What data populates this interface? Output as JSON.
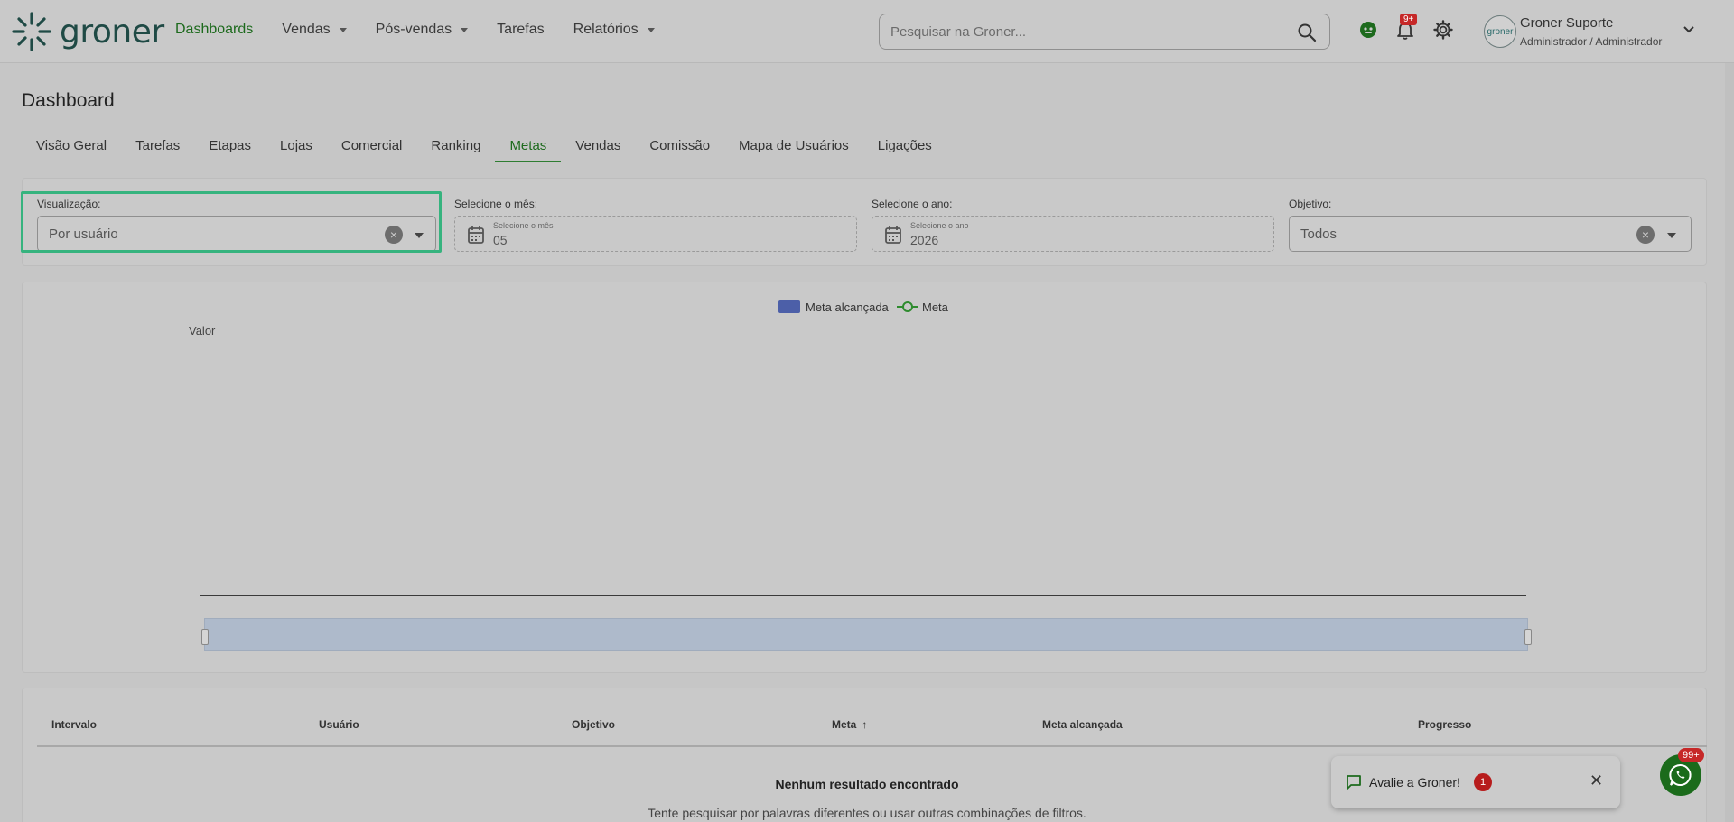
{
  "brand": {
    "name": "groner",
    "color": "#1f4a45"
  },
  "nav": {
    "items": [
      {
        "label": "Dashboards",
        "active": true,
        "dropdown": false
      },
      {
        "label": "Vendas",
        "active": false,
        "dropdown": true
      },
      {
        "label": "Pós-vendas",
        "active": false,
        "dropdown": true
      },
      {
        "label": "Tarefas",
        "active": false,
        "dropdown": false
      },
      {
        "label": "Relatórios",
        "active": false,
        "dropdown": true
      }
    ]
  },
  "search": {
    "placeholder": "Pesquisar na Groner..."
  },
  "notifications": {
    "badge": "9+"
  },
  "user": {
    "name": "Groner Suporte",
    "role": "Administrador / Administrador",
    "avatar_text": "groner"
  },
  "page": {
    "title": "Dashboard"
  },
  "tabs": [
    {
      "label": "Visão Geral"
    },
    {
      "label": "Tarefas"
    },
    {
      "label": "Etapas"
    },
    {
      "label": "Lojas"
    },
    {
      "label": "Comercial"
    },
    {
      "label": "Ranking"
    },
    {
      "label": "Metas",
      "active": true
    },
    {
      "label": "Vendas"
    },
    {
      "label": "Comissão"
    },
    {
      "label": "Mapa de Usuários"
    },
    {
      "label": "Ligações"
    }
  ],
  "filters": {
    "visualizacao": {
      "label": "Visualização:",
      "value": "Por usuário"
    },
    "mes": {
      "label": "Selecione o mês:",
      "small_label": "Selecione o mês",
      "value": "05"
    },
    "ano": {
      "label": "Selecione o ano:",
      "small_label": "Selecione o ano",
      "value": "2026"
    },
    "objetivo": {
      "label": "Objetivo:",
      "value": "Todos"
    }
  },
  "chart_data": {
    "type": "bar",
    "categories": [],
    "series": [
      {
        "name": "Meta alcançada",
        "values": []
      },
      {
        "name": "Meta",
        "values": []
      }
    ],
    "ylabel": "Valor",
    "legend": "top-center",
    "colors": {
      "Meta alcançada": "#4c5fa8",
      "Meta": "#2e8b2e"
    }
  },
  "table": {
    "headers": [
      "Intervalo",
      "Usuário",
      "Objetivo",
      "Meta",
      "Meta alcançada",
      "Progresso"
    ],
    "empty_title": "Nenhum resultado encontrado",
    "empty_subtitle": "Tente pesquisar por palavras diferentes ou usar outras combinações de filtros."
  },
  "toast": {
    "text": "Avalie a Groner!",
    "count": "1"
  },
  "whatsapp": {
    "badge": "99+"
  },
  "colors": {
    "accent": "#1d6a1d",
    "highlight": "#36b37e",
    "danger": "#c62828"
  }
}
